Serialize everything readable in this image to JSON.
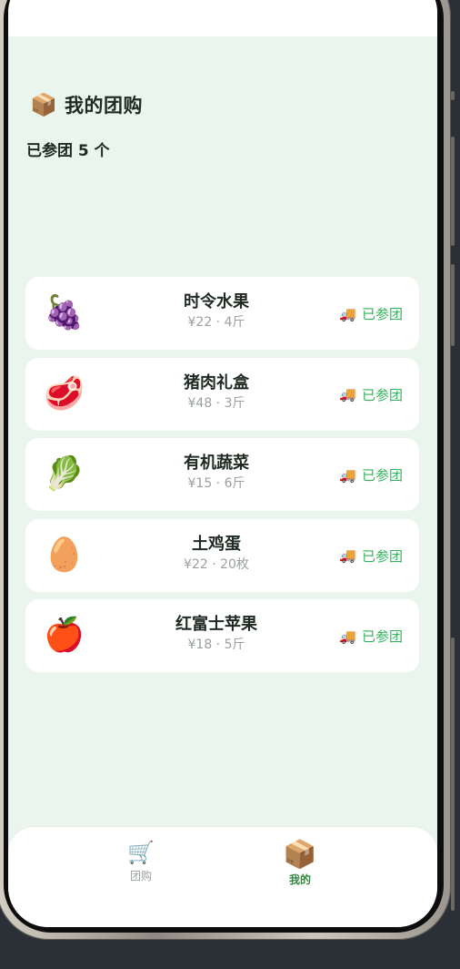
{
  "header": {
    "icon": "package-icon",
    "icon_glyph": "📦",
    "title": "我的团购"
  },
  "summary": {
    "joined_text": "已参团 5 个"
  },
  "items": [
    {
      "emoji_name": "grapes-icon",
      "emoji": "🍇",
      "name": "时令水果",
      "meta": "¥22 · 4斤",
      "status_icon": "truck-icon",
      "status_glyph": "🚚",
      "status": "已参团"
    },
    {
      "emoji_name": "meat-icon",
      "emoji": "🥩",
      "name": "猪肉礼盒",
      "meta": "¥48 · 3斤",
      "status_icon": "truck-icon",
      "status_glyph": "🚚",
      "status": "已参团"
    },
    {
      "emoji_name": "leafy-green-icon",
      "emoji": "🥬",
      "name": "有机蔬菜",
      "meta": "¥15 · 6斤",
      "status_icon": "truck-icon",
      "status_glyph": "🚚",
      "status": "已参团"
    },
    {
      "emoji_name": "egg-icon",
      "emoji": "🥚",
      "name": "土鸡蛋",
      "meta": "¥22 · 20枚",
      "status_icon": "truck-icon",
      "status_glyph": "🚚",
      "status": "已参团"
    },
    {
      "emoji_name": "apple-icon",
      "emoji": "🍎",
      "name": "红富士苹果",
      "meta": "¥18 · 5斤",
      "status_icon": "truck-icon",
      "status_glyph": "🚚",
      "status": "已参团"
    }
  ],
  "tabbar": {
    "tabs": [
      {
        "icon": "cart-icon",
        "glyph": "🛒",
        "label": "团购",
        "active": false
      },
      {
        "icon": "package-icon",
        "glyph": "📦",
        "label": "我的",
        "active": true
      }
    ]
  },
  "colors": {
    "accent": "#31b45b",
    "background": "#eaf5ee",
    "card": "#ffffff"
  }
}
